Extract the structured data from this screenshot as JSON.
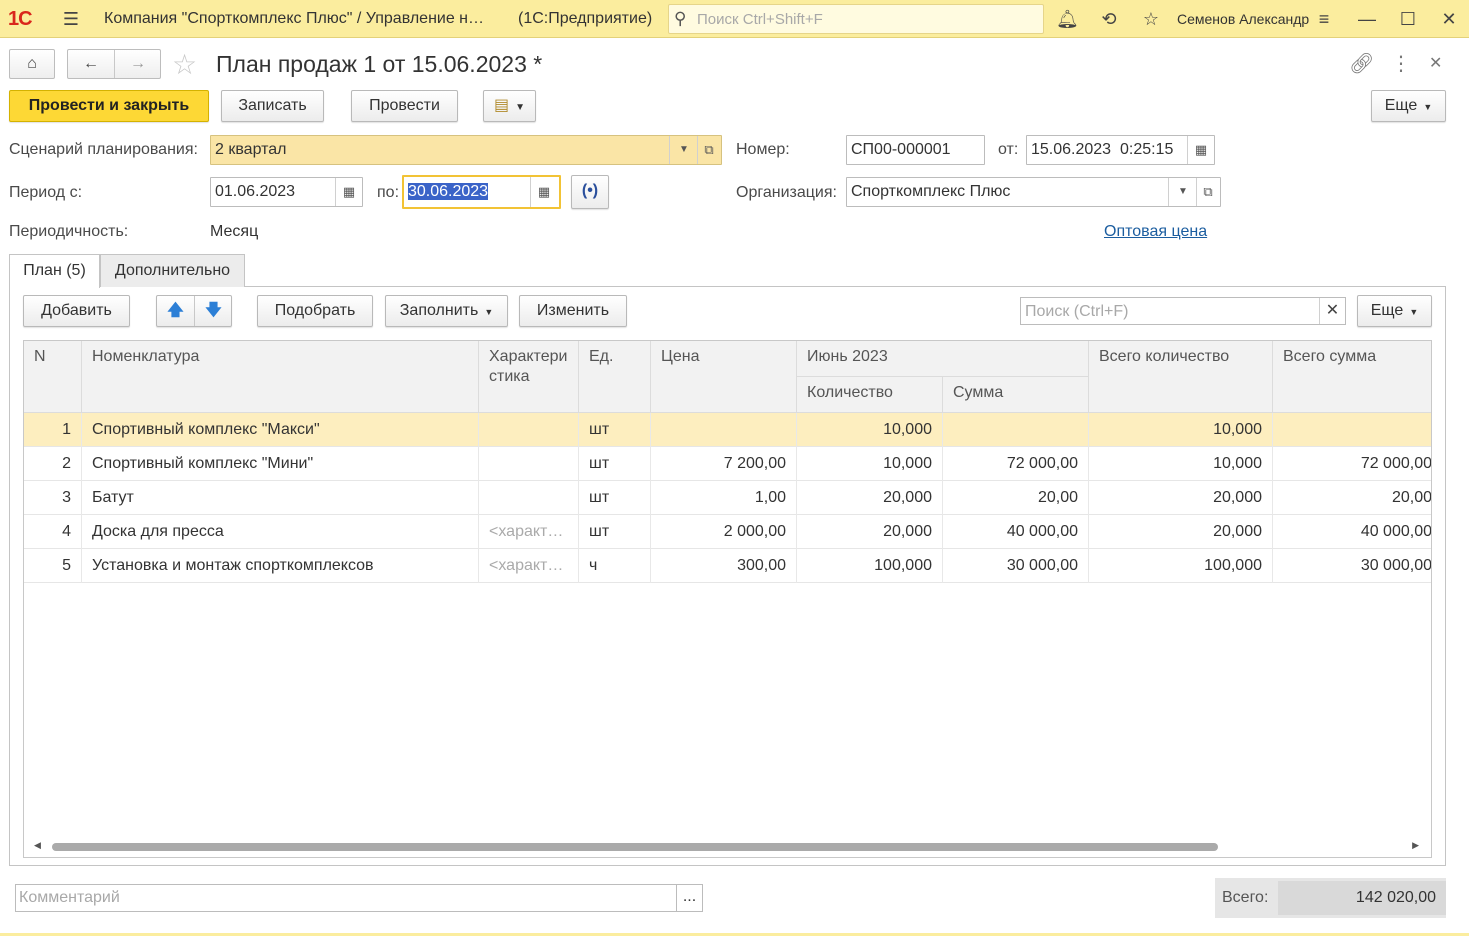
{
  "titlebar": {
    "logo": "1С",
    "company": "Компания \"Спорткомплекс Плюс\" / Управление н…",
    "app": "(1С:Предприятие)",
    "search_placeholder": "Поиск Ctrl+Shift+F",
    "user": "Семенов Александр"
  },
  "form": {
    "title": "План продаж 1 от 15.06.2023 *"
  },
  "toolbar": {
    "post_close": "Провести и закрыть",
    "save": "Записать",
    "post": "Провести",
    "more": "Еще"
  },
  "fields": {
    "scenario_label": "Сценарий планирования:",
    "scenario_value": "2 квартал",
    "number_label": "Номер:",
    "number_value": "СП00-000001",
    "date_label": "от:",
    "date_value": "15.06.2023  0:25:15",
    "period_from_label": "Период с:",
    "period_from_value": "01.06.2023",
    "period_to_label": "по:",
    "period_to_value": "30.06.2023",
    "org_label": "Организация:",
    "org_value": "Спорткомплекс Плюс",
    "periodicity_label": "Периодичность:",
    "periodicity_value": "Месяц",
    "price_link": "Оптовая цена"
  },
  "tabs": [
    {
      "label": "План (5)"
    },
    {
      "label": "Дополнительно"
    }
  ],
  "table_toolbar": {
    "add": "Добавить",
    "pick": "Подобрать",
    "fill": "Заполнить",
    "change": "Изменить",
    "search_placeholder": "Поиск (Ctrl+F)",
    "more": "Еще"
  },
  "table": {
    "headers": {
      "n": "N",
      "item": "Номенклатура",
      "characteristic": "Характеристика",
      "unit": "Ед.",
      "price": "Цена",
      "period_group": "Июнь 2023",
      "qty": "Количество",
      "sum": "Сумма",
      "total_qty": "Всего количество",
      "total_sum": "Всего сумма"
    },
    "rows": [
      {
        "n": "1",
        "item": "Спортивный комплекс \"Макси\"",
        "char": "",
        "unit": "шт",
        "price": "",
        "qty": "10,000",
        "sum": "",
        "total_qty": "10,000",
        "total_sum": ""
      },
      {
        "n": "2",
        "item": "Спортивный комплекс \"Мини\"",
        "char": "",
        "unit": "шт",
        "price": "7 200,00",
        "qty": "10,000",
        "sum": "72 000,00",
        "total_qty": "10,000",
        "total_sum": "72 000,00"
      },
      {
        "n": "3",
        "item": "Батут",
        "char": "",
        "unit": "шт",
        "price": "1,00",
        "qty": "20,000",
        "sum": "20,00",
        "total_qty": "20,000",
        "total_sum": "20,00"
      },
      {
        "n": "4",
        "item": "Доска для пресса",
        "char": "<характ…",
        "unit": "шт",
        "price": "2 000,00",
        "qty": "20,000",
        "sum": "40 000,00",
        "total_qty": "20,000",
        "total_sum": "40 000,00"
      },
      {
        "n": "5",
        "item": "Установка и монтаж спорткомплексов",
        "char": "<характ…",
        "unit": "ч",
        "price": "300,00",
        "qty": "100,000",
        "sum": "30 000,00",
        "total_qty": "100,000",
        "total_sum": "30 000,00"
      }
    ]
  },
  "footer": {
    "comment_placeholder": "Комментарий",
    "comment_button": "...",
    "total_label": "Всего:",
    "total_value": "142 020,00"
  }
}
